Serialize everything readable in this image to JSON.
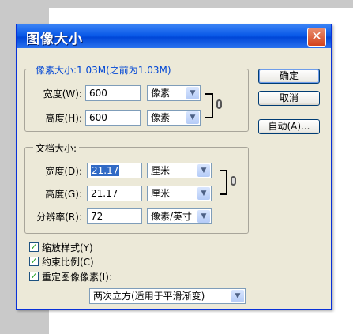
{
  "window": {
    "title": "图像大小",
    "close_glyph": "✕"
  },
  "pixel_dimensions": {
    "legend": "像素大小:1.03M(之前为1.03M)",
    "width_label": "宽度(W):",
    "width_value": "600",
    "width_unit": "像素",
    "height_label": "高度(H):",
    "height_value": "600",
    "height_unit": "像素"
  },
  "document_size": {
    "legend": "文档大小:",
    "width_label": "宽度(D):",
    "width_value": "21.17",
    "width_unit": "厘米",
    "height_label": "高度(G):",
    "height_value": "21.17",
    "height_unit": "厘米",
    "resolution_label": "分辨率(R):",
    "resolution_value": "72",
    "resolution_unit": "像素/英寸"
  },
  "buttons": {
    "ok": "确定",
    "cancel": "取消",
    "auto": "自动(A)..."
  },
  "options": {
    "scale_styles": "缩放样式(Y)",
    "constrain_proportions": "约束比例(C)",
    "resample_image": "重定图像像素(I):",
    "resample_method": "两次立方(适用于平滑渐变)"
  },
  "check_glyph": "✓",
  "arrow_glyph": "▼"
}
